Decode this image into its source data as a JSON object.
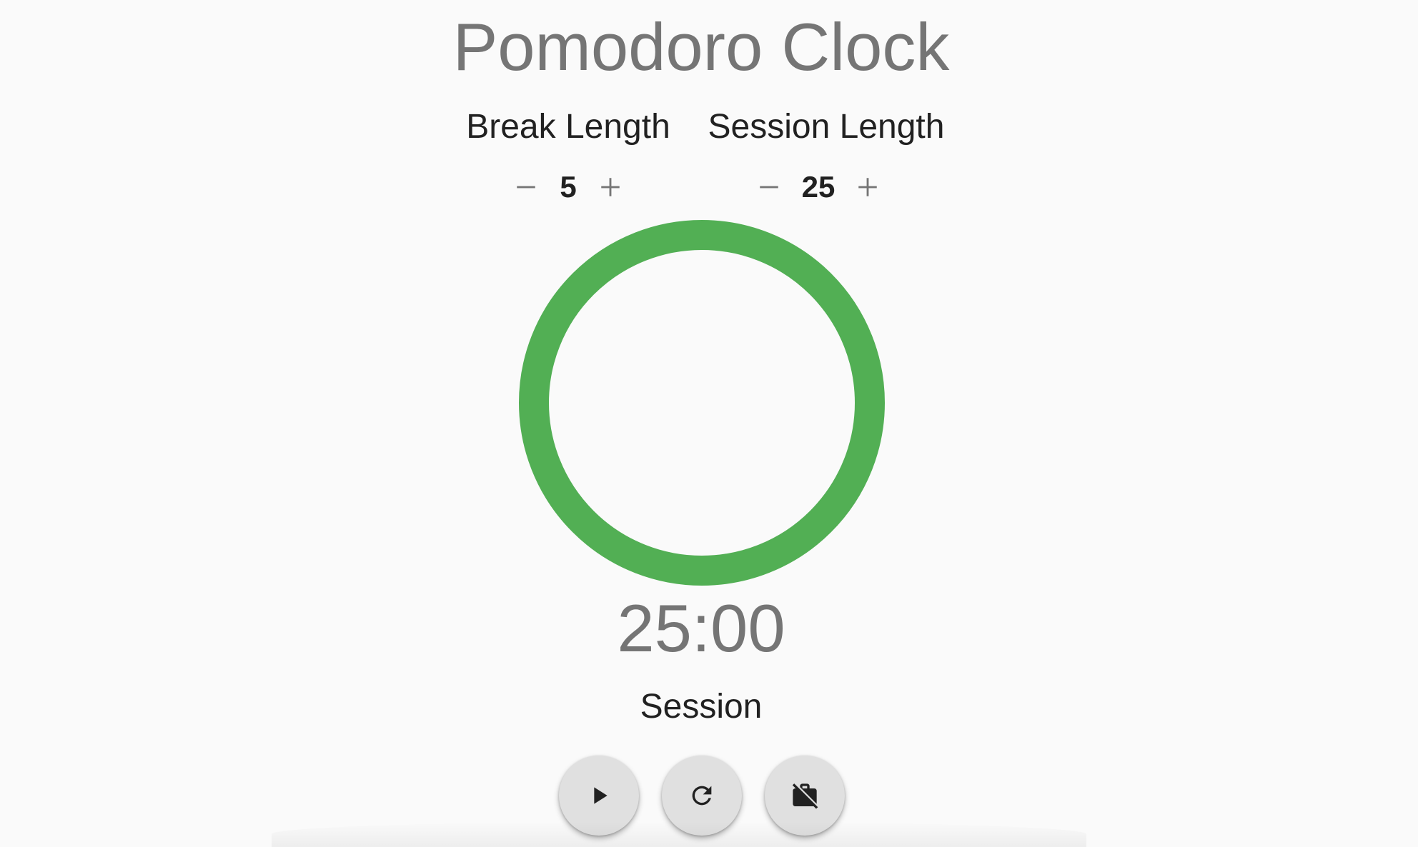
{
  "header": {
    "title": "Pomodoro Clock"
  },
  "break_setting": {
    "label": "Break Length",
    "value": "5"
  },
  "session_setting": {
    "label": "Session Length",
    "value": "25"
  },
  "timer": {
    "time": "25:00",
    "mode": "Session",
    "progress": 1.0,
    "ring_color": "#52af54"
  },
  "controls": {
    "play_icon": "play-icon",
    "reset_icon": "refresh-icon",
    "work_off_icon": "work-off-icon"
  }
}
